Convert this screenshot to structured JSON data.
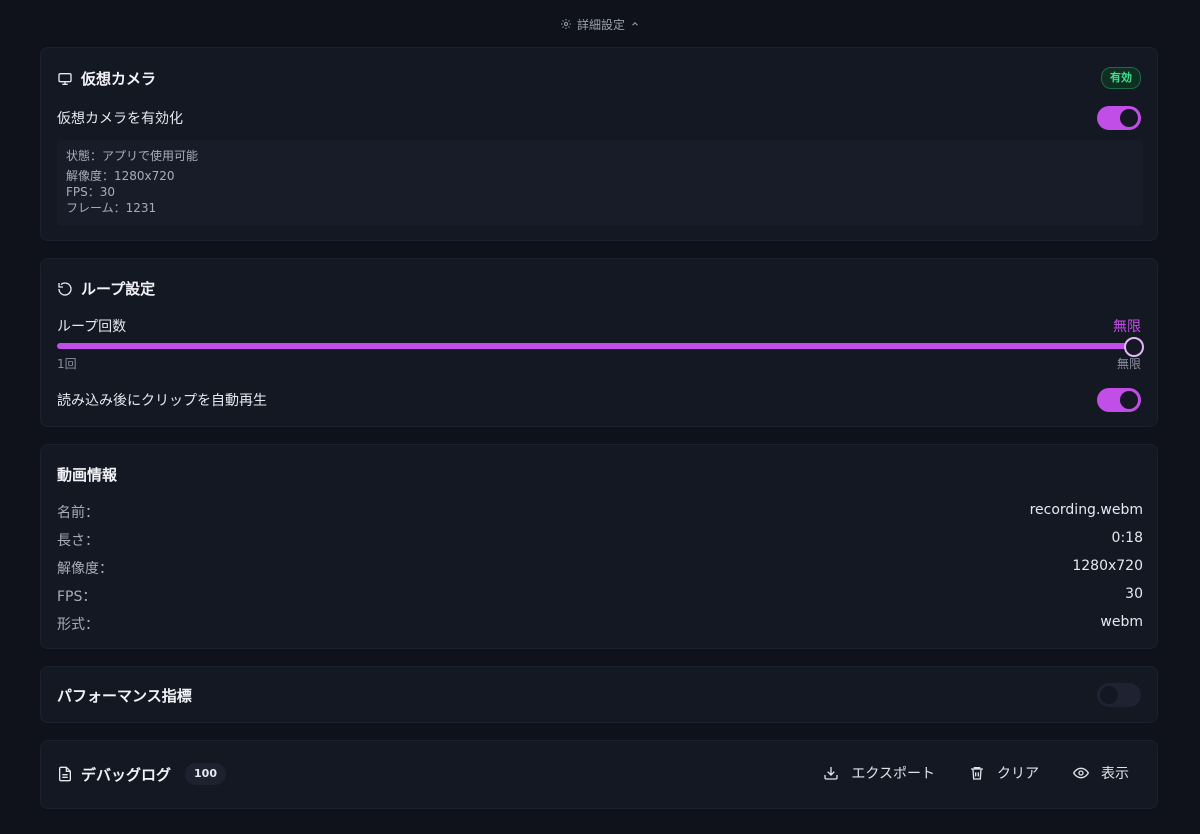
{
  "top": {
    "label": "詳細設定"
  },
  "virtual_camera": {
    "title": "仮想カメラ",
    "badge": "有効",
    "enable_label": "仮想カメラを有効化",
    "enabled": true,
    "status_lines": [
      "状態：アプリで使用可能",
      "解像度：1280x720",
      "FPS：30",
      "フレーム：1231"
    ]
  },
  "loop": {
    "title": "ループ設定",
    "count_label": "ループ回数",
    "count_value": "無限",
    "slider_min": "1回",
    "slider_max": "無限",
    "slider_fraction": 1.0,
    "autoplay_label": "読み込み後にクリップを自動再生",
    "autoplay": true
  },
  "video_info": {
    "title": "動画情報",
    "rows": [
      {
        "key": "名前：",
        "value": "recording.webm"
      },
      {
        "key": "長さ：",
        "value": "0:18"
      },
      {
        "key": "解像度：",
        "value": "1280x720"
      },
      {
        "key": "FPS：",
        "value": "30"
      },
      {
        "key": "形式：",
        "value": "webm"
      }
    ]
  },
  "performance": {
    "title": "パフォーマンス指標",
    "enabled": false
  },
  "debug_log": {
    "title": "デバッグログ",
    "count": "100",
    "export_label": "エクスポート",
    "clear_label": "クリア",
    "show_label": "表示"
  },
  "colors": {
    "accent": "#c24ee8",
    "success": "#3fe08a",
    "background": "#0f121a",
    "card": "#141823"
  }
}
